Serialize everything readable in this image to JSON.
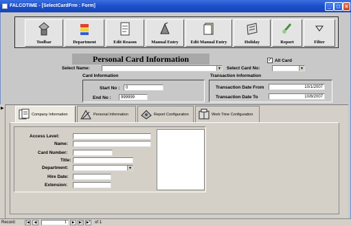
{
  "window": {
    "title": "FALCOTIME - [SelectCardFrm : Form]"
  },
  "toolbar": {
    "buttons": [
      {
        "label": "Toolbar",
        "icon": "toolbar-icon"
      },
      {
        "label": "Department",
        "icon": "department-icon"
      },
      {
        "label": "Edit Reason",
        "icon": "edit-reason-icon"
      },
      {
        "label": "Manual Entry",
        "icon": "manual-entry-icon"
      },
      {
        "label": "Edit Manual Entry",
        "icon": "edit-manual-entry-icon"
      },
      {
        "label": "Holiday",
        "icon": "holiday-icon"
      },
      {
        "label": "Report",
        "icon": "report-icon"
      },
      {
        "label": "Filter",
        "icon": "filter-icon"
      }
    ]
  },
  "form": {
    "title": "Personal Card Information",
    "all_card_label": "All Card",
    "select_name_label": "Select Name:",
    "select_name_value": "",
    "select_card_label": "Select Card No:",
    "select_card_value": "",
    "card_info_label": "Card Information",
    "start_no_label": "Start No :",
    "start_no_value": "0",
    "end_no_label": "End No :",
    "end_no_value": "999999",
    "trans_info_label": "Transaction Information",
    "trans_from_label": "Transaction Date From",
    "trans_from_value": "10/1/2007",
    "trans_to_label": "Transaction Date To",
    "trans_to_value": "10/8/2007"
  },
  "tabs": [
    {
      "label": "Company Information",
      "icon": "company-icon"
    },
    {
      "label": "Personal Information",
      "icon": "personal-icon"
    },
    {
      "label": "Report Configuration",
      "icon": "report-config-icon"
    },
    {
      "label": "Work Time Configuration",
      "icon": "work-time-icon"
    }
  ],
  "company": {
    "access_level_label": "Access Level:",
    "name_label": "Name:",
    "card_number_label": "Card Number:",
    "title_label": "Title:",
    "department_label": "Department:",
    "hire_date_label": "Hire Date:",
    "extension_label": "Extension:"
  },
  "record": {
    "label": "Record:",
    "current": "1",
    "of_label": "of 1"
  }
}
